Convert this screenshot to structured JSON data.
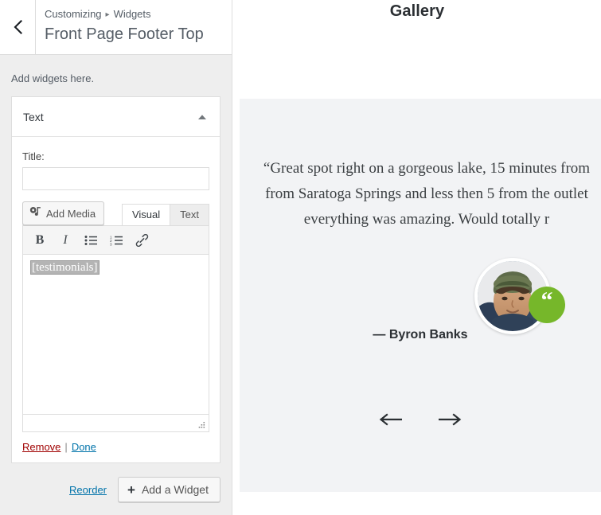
{
  "sidebar": {
    "back_icon": "chevron-left-icon",
    "breadcrumb_root": "Customizing",
    "breadcrumb_sep": "▸",
    "breadcrumb_current": "Widgets",
    "panel_title": "Front Page Footer Top",
    "add_widgets_note": "Add widgets here.",
    "widget": {
      "name": "Text",
      "toggle_icon": "caret-up-icon",
      "title_label": "Title:",
      "title_value": "",
      "title_placeholder": "",
      "add_media_label": "Add Media",
      "add_media_icon": "media-icon",
      "tabs": [
        {
          "label": "Visual",
          "active": true
        },
        {
          "label": "Text",
          "active": false
        }
      ],
      "toolbar": [
        {
          "icon": "bold-icon",
          "label": "B"
        },
        {
          "icon": "italic-icon",
          "label": "I"
        },
        {
          "icon": "bulleted-list-icon",
          "label": ""
        },
        {
          "icon": "numbered-list-icon",
          "label": ""
        },
        {
          "icon": "link-icon",
          "label": ""
        }
      ],
      "content": "[testimonials]",
      "resize_icon": "resize-grip-icon",
      "remove_label": "Remove",
      "separator": "|",
      "done_label": "Done"
    },
    "reorder_label": "Reorder",
    "add_widget_label": "Add a Widget",
    "add_widget_icon": "plus-icon"
  },
  "preview": {
    "gallery_title": "Gallery",
    "quote_lines": [
      "“Great spot right on a gorgeous lake, 15 minutes from",
      "from Saratoga Springs and less then 5 from the outlet",
      "everything was amazing. Would totally r"
    ],
    "author": "— Byron Banks",
    "badge_glyph": "“",
    "avatar_icon": "user-avatar-photo",
    "prev_icon": "arrow-left-icon",
    "next_icon": "arrow-right-icon"
  },
  "colors": {
    "accent_green": "#76b72a",
    "link_blue": "#0073aa",
    "danger_red": "#a00000",
    "sidebar_bg": "#eeeeee",
    "preview_section_bg": "#f2f3f5"
  }
}
